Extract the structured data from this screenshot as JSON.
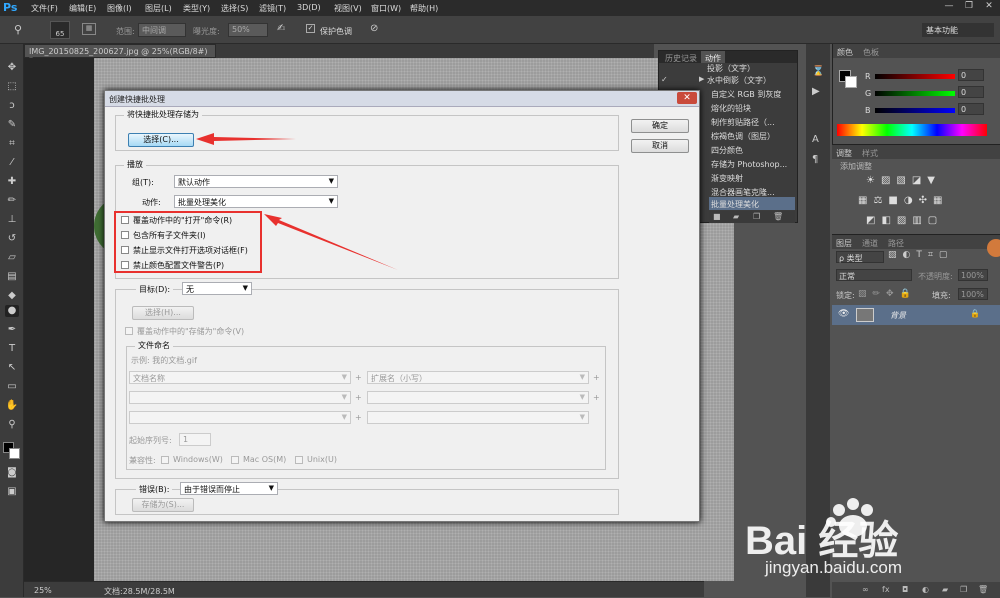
{
  "app": {
    "logo": "Ps"
  },
  "menubar": {
    "items": [
      "文件(F)",
      "编辑(E)",
      "图像(I)",
      "图层(L)",
      "类型(Y)",
      "选择(S)",
      "滤镜(T)",
      "3D(D)",
      "视图(V)",
      "窗口(W)",
      "帮助(H)"
    ],
    "minimize": "—",
    "restore": "❐",
    "close": "✕"
  },
  "options": {
    "brush_size": "65",
    "range_label": "范围:",
    "range_value": "中间调",
    "exposure_label": "曝光度:",
    "exposure_value": "50%",
    "protect_label": "保护色调",
    "workspace": "基本功能"
  },
  "document": {
    "tab_title": "IMG_20150825_200627.jpg @ 25%(RGB/8#) *",
    "zoom": "25%",
    "doc_info": "文档:28.5M/28.5M"
  },
  "actions_panel": {
    "tabs": [
      "历史记录",
      "动作"
    ],
    "items": [
      "投影（文字）",
      "水中倒影（文字）",
      "自定义 RGB 到灰度",
      "熔化的铅块",
      "制作剪贴路径（...",
      "棕褐色调（图层）",
      "四分颜色",
      "存储为 Photoshop...",
      "渐变映射",
      "混合器画笔克隆...",
      "批量处理美化"
    ]
  },
  "color_panel": {
    "tabs": [
      "颜色",
      "色板"
    ],
    "channels": [
      "R",
      "G",
      "B"
    ],
    "values": [
      "0",
      "0",
      "0"
    ]
  },
  "adjust_panel": {
    "tabs": [
      "调整",
      "样式"
    ],
    "hint": "添加调整"
  },
  "layers_panel": {
    "tabs": [
      "图层",
      "通道",
      "路径"
    ],
    "kind_label": "ρ 类型",
    "blend_mode": "正常",
    "opacity_label": "不透明度:",
    "opacity_value": "100%",
    "lock_label": "锁定:",
    "fill_label": "填充:",
    "fill_value": "100%",
    "layer_name": "背景"
  },
  "dialog": {
    "title": "创建快捷批处理",
    "close": "✕",
    "save_group": "将快捷批处理存储为",
    "choose_button": "选择(C)...",
    "ok_button": "确定",
    "cancel_button": "取消",
    "play_group": "播放",
    "set_label": "组(T):",
    "set_value": "默认动作",
    "action_label": "动作:",
    "action_value": "批量处理美化",
    "opt_override_open": "覆盖动作中的\"打开\"命令(R)",
    "opt_include_sub": "包含所有子文件夹(I)",
    "opt_suppress_dialog": "禁止显示文件打开选项对话框(F)",
    "opt_suppress_profile": "禁止颜色配置文件警告(P)",
    "dest_label": "目标(D):",
    "dest_value": "无",
    "dest_choose": "选择(H)...",
    "opt_override_save": "覆盖动作中的\"存储为\"命令(V)",
    "naming_group": "文件命名",
    "example": "示例: 我的文档.gif",
    "name_field1": "文档名称",
    "name_field2": "扩展名（小写）",
    "plus": "+",
    "serial_label": "起始序列号:",
    "serial_value": "1",
    "compat_label": "兼容性:",
    "compat_windows": "Windows(W)",
    "compat_mac": "Mac OS(M)",
    "compat_unix": "Unix(U)",
    "error_label": "错误(B):",
    "error_value": "由于错误而停止",
    "save_as_button": "存储为(S)..."
  },
  "watermark": {
    "brand": "Bai  经验",
    "url": "jingyan.baidu.com"
  },
  "colors": {
    "annotation_red": "#e8312e",
    "ps_blue": "#31a8ff"
  }
}
